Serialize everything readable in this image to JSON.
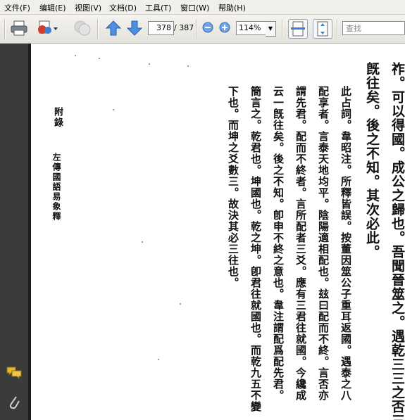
{
  "menu": {
    "items": [
      "文件(F)",
      "编辑(E)",
      "视图(V)",
      "文档(D)",
      "工具(T)",
      "窗口(W)",
      "帮助(H)"
    ]
  },
  "toolbar": {
    "page_current": "378",
    "page_total": "/ 387",
    "zoom": "114%",
    "search_placeholder": "查找"
  },
  "sidebar": {
    "icons": [
      "comments-icon",
      "attachment-icon"
    ]
  },
  "document": {
    "margin_title": "附錄",
    "margin_subtitle": "左傳國語易象釋",
    "columns": [
      "祚。可以得國。成公之歸也。吾聞晉筮之。遇乾三三之否三",
      "旣往矣。後之不知。其次必此。",
      "此占詞。韋昭注。所釋皆誤。按董因筮公子重耳返國。遇泰之八",
      "配享者。言泰天地均平。陰陽適相配也。玆曰配而不終。言否亦",
      "謂先君。配而不終者。言所配者三爻。應有三君往就國。今纔成",
      "云一旣往矣。後之不知。卽申不終之意也。韋注謂配爲配先君。",
      "簡言之。乾君也。坤國也。乾之坤。卽君往就國也。而乾九五不變",
      "下也。而坤之爻數三。故決其必三往也。"
    ]
  }
}
